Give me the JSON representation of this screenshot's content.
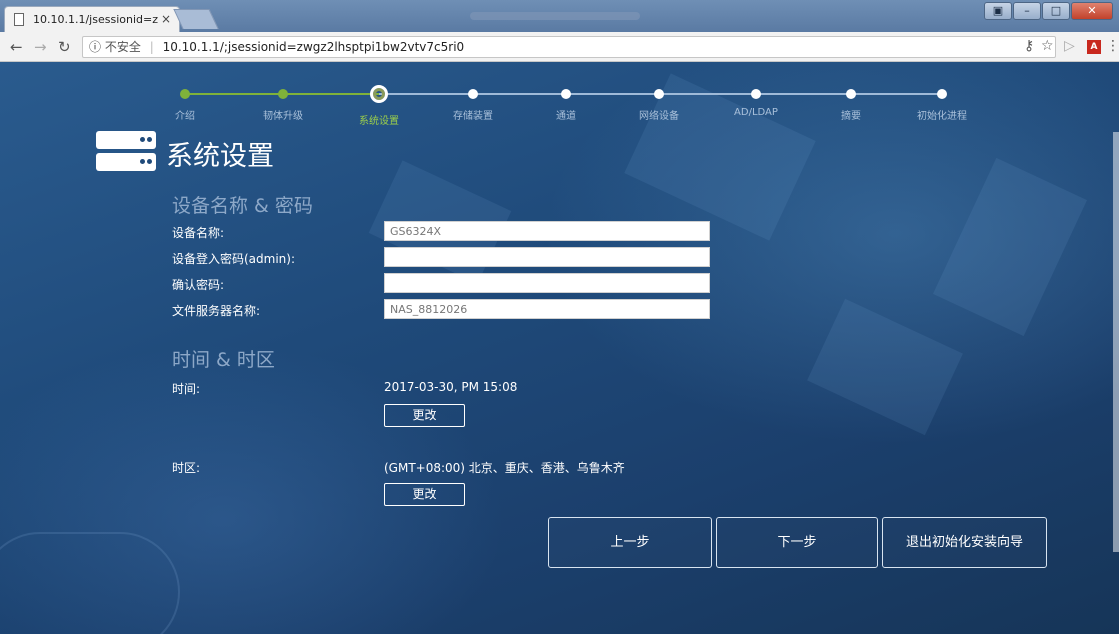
{
  "browser": {
    "tab_title": "10.10.1.1/jsessionid=z",
    "tab_close": "×",
    "security_label": "不安全",
    "url": "10.10.1.1/;jsessionid=zwgz2lhsptpi1bw2vtv7c5ri0"
  },
  "stepper": {
    "steps": [
      "介绍",
      "韧体升级",
      "系统设置",
      "存储装置",
      "通道",
      "网络设备",
      "AD/LDAP",
      "摘要",
      "初始化进程"
    ],
    "current_index": 2
  },
  "page": {
    "title": "系统设置"
  },
  "device_section": {
    "title": "设备名称 & 密码",
    "device_name_label": "设备名称:",
    "device_name_value": "GS6324X",
    "admin_password_label": "设备登入密码(admin):",
    "admin_password_value": "",
    "confirm_password_label": "确认密码:",
    "confirm_password_value": "",
    "file_server_label": "文件服务器名称:",
    "file_server_value": "NAS_8812026"
  },
  "time_section": {
    "title": "时间 & 时区",
    "time_label": "时间:",
    "time_value": "2017-03-30, PM 15:08",
    "time_change": "更改",
    "zone_label": "时区:",
    "zone_value": "(GMT+08:00) 北京、重庆、香港、乌鲁木齐",
    "zone_change": "更改"
  },
  "actions": {
    "prev": "上一步",
    "next": "下一步",
    "exit": "退出初始化安装向导"
  },
  "colors": {
    "accent_green": "#7fb23a",
    "background": "#1f4a7a"
  }
}
